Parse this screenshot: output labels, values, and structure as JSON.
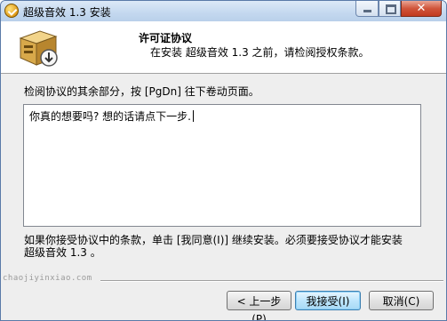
{
  "window": {
    "title": "超级音效 1.3 安装"
  },
  "header": {
    "title": "许可证协议",
    "subtitle": "在安装 超级音效 1.3 之前，请检阅授权条款。"
  },
  "body": {
    "instruction": "检阅协议的其余部分，按 [PgDn] 往下卷动页面。",
    "license_text": "你真的想要吗? 想的话请点下一步.",
    "agreement_note_line1": "如果你接受协议中的条款，单击 [我同意(I)] 继续安装。必须要接受协议才能安装",
    "agreement_note_line2": "超级音效 1.3 。"
  },
  "watermark": "chaojiyinxiao.com",
  "buttons": {
    "back": "< 上一步(P)",
    "accept": "我接受(I)",
    "cancel": "取消(C)"
  },
  "icons": {
    "app": "installer-app-icon",
    "header": "installer-box-icon"
  },
  "colors": {
    "titlebar": "#c4d8ef",
    "close_button": "#c23a1f",
    "default_button_border": "#3c7fb1"
  }
}
